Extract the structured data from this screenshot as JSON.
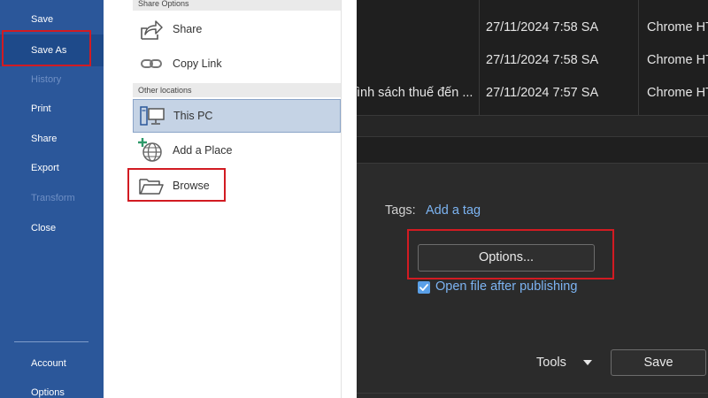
{
  "sidebar": {
    "items": [
      {
        "label": "Save",
        "state": "normal"
      },
      {
        "label": "Save As",
        "state": "selected"
      },
      {
        "label": "History",
        "state": "disabled"
      },
      {
        "label": "Print",
        "state": "normal"
      },
      {
        "label": "Share",
        "state": "normal"
      },
      {
        "label": "Export",
        "state": "normal"
      },
      {
        "label": "Transform",
        "state": "disabled"
      },
      {
        "label": "Close",
        "state": "normal"
      }
    ],
    "bottom_items": [
      {
        "label": "Account"
      },
      {
        "label": "Options"
      }
    ]
  },
  "middle": {
    "share_header": "Share Options",
    "share_items": [
      {
        "label": "Share",
        "icon": "share-arrow-icon"
      },
      {
        "label": "Copy Link",
        "icon": "link-icon"
      }
    ],
    "other_header": "Other locations",
    "location_items": [
      {
        "label": "This PC",
        "icon": "computer-icon",
        "selected": true
      },
      {
        "label": "Add a Place",
        "icon": "globe-add-icon"
      },
      {
        "label": "Browse",
        "icon": "folder-icon"
      }
    ]
  },
  "dialog": {
    "files": [
      {
        "name": "",
        "date": "27/11/2024 7:58 SA",
        "type": "Chrome HT"
      },
      {
        "name": "",
        "date": "27/11/2024 7:58 SA",
        "type": "Chrome HT"
      },
      {
        "name": "ình sách thuế đến ...",
        "date": "27/11/2024 7:57 SA",
        "type": "Chrome HT"
      }
    ],
    "tags_label": "Tags:",
    "tags_link": "Add a tag",
    "options_button": "Options...",
    "open_after_publish": "Open file after publishing",
    "tools_label": "Tools",
    "save_button": "Save"
  },
  "colors": {
    "sidebar_bg": "#2b579a",
    "highlight_red": "#d21b22",
    "dialog_bg": "#1f1f1f",
    "link_blue": "#7cb4f2"
  }
}
